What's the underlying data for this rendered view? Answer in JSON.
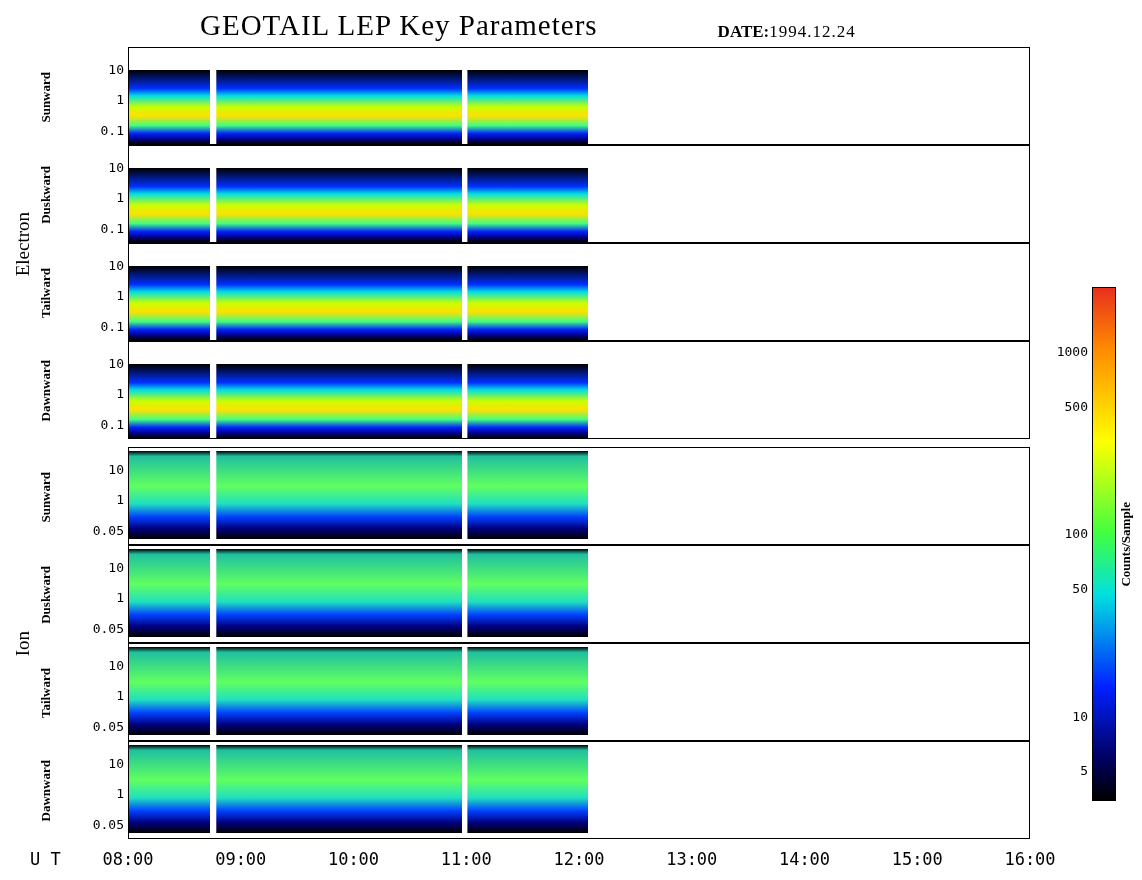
{
  "title": "GEOTAIL LEP Key Parameters",
  "date": {
    "label": "DATE:",
    "value": "1994.12.24"
  },
  "groups": [
    {
      "name": "Electron",
      "kind": "electron",
      "panels": [
        {
          "label": "Sunward",
          "yticks": [
            "10",
            "1",
            "0.1"
          ]
        },
        {
          "label": "Duskward",
          "yticks": [
            "10",
            "1",
            "0.1"
          ]
        },
        {
          "label": "Tailward",
          "yticks": [
            "10",
            "1",
            "0.1"
          ]
        },
        {
          "label": "Dawnward",
          "yticks": [
            "10",
            "1",
            "0.1"
          ]
        }
      ]
    },
    {
      "name": "Ion",
      "kind": "ion",
      "panels": [
        {
          "label": "Sunward",
          "yticks": [
            "10",
            "1",
            "0.05"
          ]
        },
        {
          "label": "Duskward",
          "yticks": [
            "10",
            "1",
            "0.05"
          ]
        },
        {
          "label": "Tailward",
          "yticks": [
            "10",
            "1",
            "0.05"
          ]
        },
        {
          "label": "Dawnward",
          "yticks": [
            "10",
            "1",
            "0.05"
          ]
        }
      ]
    }
  ],
  "x_axis": {
    "label": "U T",
    "ticks": [
      "08:00",
      "09:00",
      "10:00",
      "11:00",
      "12:00",
      "13:00",
      "14:00",
      "15:00",
      "16:00"
    ]
  },
  "colorbar": {
    "label": "Counts/Sample",
    "ticks": [
      "1000",
      "500",
      "100",
      "50",
      "10",
      "5"
    ]
  }
}
